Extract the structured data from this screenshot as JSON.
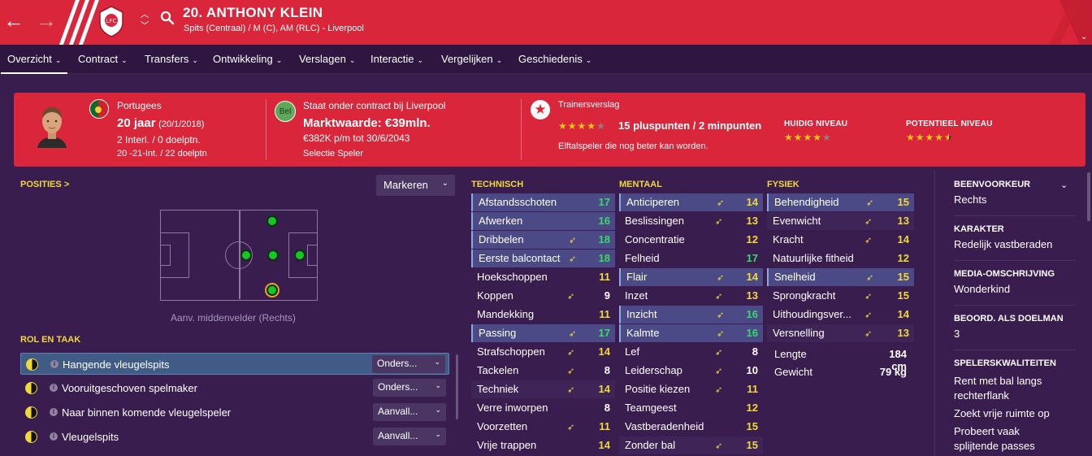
{
  "header": {
    "player_title": "20. ANTHONY KLEIN",
    "subtitle": "Spits (Centraal) / M (C), AM (RLC) - Liverpool"
  },
  "tabs": [
    {
      "label": "Overzicht"
    },
    {
      "label": "Contract"
    },
    {
      "label": "Transfers"
    },
    {
      "label": "Ontwikkeling"
    },
    {
      "label": "Verslagen"
    },
    {
      "label": "Interactie"
    },
    {
      "label": "Vergelijken"
    },
    {
      "label": "Geschiedenis"
    }
  ],
  "profile": {
    "nationality": "Portugees",
    "age": "20 jaar",
    "dob": "(20/1/2018)",
    "caps": "2 Interl. / 0 doelptn.",
    "youth_caps": "20 -21-Int. / 22 doelptn",
    "club_badge": "Bel",
    "contract_status": "Staat onder contract bij Liverpool",
    "value": "Marktwaarde: €39mln.",
    "wage": "€382K p/m tot 30/6/2043",
    "squad_status": "Selectie Speler",
    "report_label": "Trainersverslag",
    "report_summary": "15 pluspunten / 2 minpunten",
    "report_text": "Elftalspeler die nog beter kan worden.",
    "report_stars": 4,
    "current_label": "HUIDIG NIVEAU",
    "current_stars": 4,
    "potential_label": "POTENTIEEL NIVEAU",
    "potential_stars": 4.5
  },
  "positions": {
    "label": "POSITIES",
    "chevron": ">",
    "mark_select": "Markeren",
    "caption": "Aanv. middenvelder (Rechts)"
  },
  "roles": {
    "label": "ROL EN TAAK",
    "items": [
      {
        "name": "Hangende vleugelspits",
        "duty": "Onders..."
      },
      {
        "name": "Vooruitgeschoven spelmaker",
        "duty": "Onders..."
      },
      {
        "name": "Naar binnen komende vleugelspeler",
        "duty": "Aanvall..."
      },
      {
        "name": "Vleugelspits",
        "duty": "Aanvall..."
      }
    ]
  },
  "technical": {
    "label": "TECHNISCH",
    "items": [
      {
        "name": "Afstandsschoten",
        "value": "17"
      },
      {
        "name": "Afwerken",
        "value": "16"
      },
      {
        "name": "Dribbelen",
        "value": "18"
      },
      {
        "name": "Eerste balcontact",
        "value": "18"
      },
      {
        "name": "Hoekschoppen",
        "value": "11"
      },
      {
        "name": "Koppen",
        "value": "9"
      },
      {
        "name": "Mandekking",
        "value": "11"
      },
      {
        "name": "Passing",
        "value": "17"
      },
      {
        "name": "Strafschoppen",
        "value": "14"
      },
      {
        "name": "Tackelen",
        "value": "8"
      },
      {
        "name": "Techniek",
        "value": "14"
      },
      {
        "name": "Verre inworpen",
        "value": "8"
      },
      {
        "name": "Voorzetten",
        "value": "11"
      },
      {
        "name": "Vrije trappen",
        "value": "14"
      }
    ]
  },
  "mental": {
    "label": "MENTAAL",
    "items": [
      {
        "name": "Anticiperen",
        "value": "14"
      },
      {
        "name": "Beslissingen",
        "value": "13"
      },
      {
        "name": "Concentratie",
        "value": "12"
      },
      {
        "name": "Felheid",
        "value": "17"
      },
      {
        "name": "Flair",
        "value": "14"
      },
      {
        "name": "Inzet",
        "value": "13"
      },
      {
        "name": "Inzicht",
        "value": "16"
      },
      {
        "name": "Kalmte",
        "value": "16"
      },
      {
        "name": "Lef",
        "value": "8"
      },
      {
        "name": "Leiderschap",
        "value": "10"
      },
      {
        "name": "Positie kiezen",
        "value": "11"
      },
      {
        "name": "Teamgeest",
        "value": "12"
      },
      {
        "name": "Vastberadenheid",
        "value": "15"
      },
      {
        "name": "Zonder bal",
        "value": "15"
      }
    ]
  },
  "physical": {
    "label": "FYSIEK",
    "items": [
      {
        "name": "Behendigheid",
        "value": "15"
      },
      {
        "name": "Evenwicht",
        "value": "13"
      },
      {
        "name": "Kracht",
        "value": "14"
      },
      {
        "name": "Natuurlijke fitheid",
        "value": "12"
      },
      {
        "name": "Snelheid",
        "value": "15"
      },
      {
        "name": "Sprongkracht",
        "value": "15"
      },
      {
        "name": "Uithoudingsver...",
        "value": "14"
      },
      {
        "name": "Versnelling",
        "value": "13"
      }
    ],
    "height_label": "Lengte",
    "height": "184 cm",
    "weight_label": "Gewicht",
    "weight": "79 kg"
  },
  "info_panel": {
    "foot_label": "BEENVOORKEUR",
    "foot": "Rechts",
    "personality_label": "KARAKTER",
    "personality": "Redelijk vastberaden",
    "media_label": "MEDIA-OMSCHRIJVING",
    "media": "Wonderkind",
    "gk_label": "BEOORD. ALS DOELMAN",
    "gk": "3",
    "traits_label": "SPELERSKWALITEITEN",
    "traits": [
      "Rent met bal langs rechterflank",
      "Zoekt vrije ruimte op",
      "Probeert vaak splijtende passes"
    ]
  },
  "colors": {
    "header_red": "#d9263a",
    "background": "#3a1d4f",
    "good": "#38d96a",
    "average": "#f0d93a"
  }
}
